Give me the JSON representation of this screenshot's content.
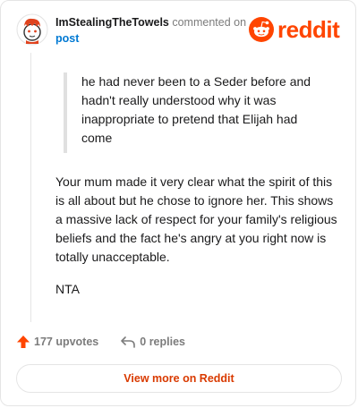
{
  "header": {
    "username": "ImStealingTheTowels",
    "action_text": "commented on",
    "post_link": "post",
    "logo_text": "reddit"
  },
  "comment": {
    "quote": "he had never been to a Seder before and hadn't really understood why it was inappropriate to pretend that Elijah had come",
    "body": "Your mum made it very clear what the spirit of this is all about but he chose to ignore her. This shows a massive lack of respect for your family's religious beliefs and the fact he's angry at you right now is totally unacceptable.",
    "verdict": "NTA"
  },
  "actions": {
    "upvotes": "177 upvotes",
    "replies": "0 replies"
  },
  "footer": {
    "view_button": "View more on Reddit"
  },
  "icons": {
    "avatar": "snoo-avatar-icon",
    "logo": "reddit-logo-icon",
    "upvote": "upvote-arrow-icon",
    "reply": "reply-arrow-icon"
  },
  "colors": {
    "brand": "#ff4500",
    "link": "#0079d3",
    "button_text": "#d93a00",
    "muted": "#7c7c7c"
  }
}
